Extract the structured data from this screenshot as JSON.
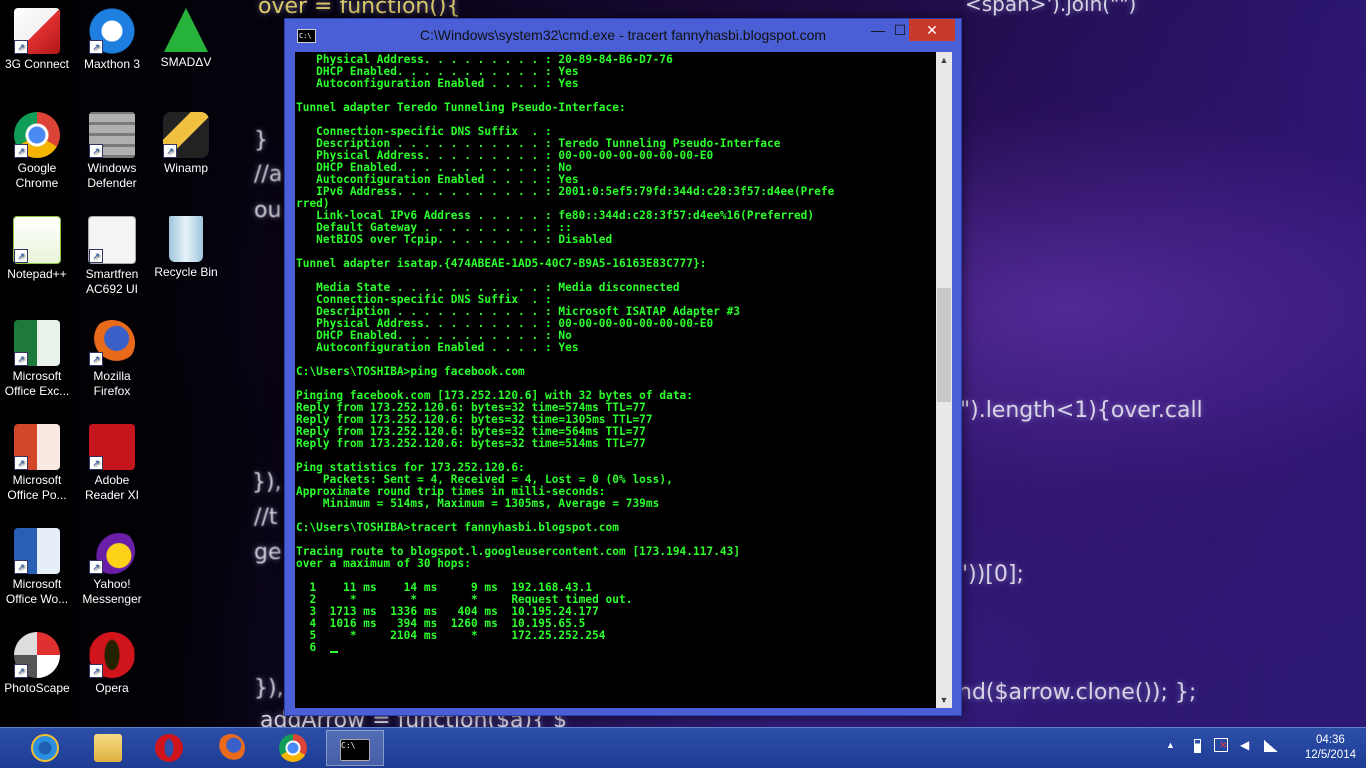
{
  "wallpaper": {
    "lines": [
      "over = function(){",
      "}",
      "//a",
      "ou",
      "}),",
      "//t",
      "ge",
      "}),",
      "addArrow = function($a){ $",
      "\").length<1){over.call",
      "\"))[0];",
      "nd($arrow.clone()); };",
      "<span>').join(\"\")"
    ]
  },
  "desktop_icons": [
    {
      "label": "3G Connect",
      "icon": "3g-connect-icon",
      "color": "#e03030"
    },
    {
      "label": "Maxthon 3",
      "icon": "maxthon-icon",
      "color": "#1e7fe0"
    },
    {
      "label": "SMADΔV",
      "icon": "smadav-icon",
      "color": "#27b23a"
    },
    {
      "label": "Google Chrome",
      "icon": "chrome-icon",
      "color": "#e8b020"
    },
    {
      "label": "Windows Defender",
      "icon": "windows-defender-icon",
      "color": "#9a9a9a"
    },
    {
      "label": "Winamp",
      "icon": "winamp-icon",
      "color": "#d8a020"
    },
    {
      "label": "Notepad++",
      "icon": "notepadpp-icon",
      "color": "#8fc040"
    },
    {
      "label": "Smartfren AC692 UI",
      "icon": "smartfren-icon",
      "color": "#d02030"
    },
    {
      "label": "Recycle Bin",
      "icon": "recycle-bin-icon",
      "color": "#cfe4f2"
    },
    {
      "label": "Microsoft Office Exc...",
      "icon": "excel-icon",
      "color": "#1e7a3c"
    },
    {
      "label": "Mozilla Firefox",
      "icon": "firefox-icon",
      "color": "#e86a1a"
    },
    {
      "label": "Microsoft Office Po...",
      "icon": "powerpoint-icon",
      "color": "#d2472a"
    },
    {
      "label": "Adobe Reader XI",
      "icon": "adobe-reader-icon",
      "color": "#c4161c"
    },
    {
      "label": "Microsoft Office Wo...",
      "icon": "word-icon",
      "color": "#2b5fb4"
    },
    {
      "label": "Yahoo! Messenger",
      "icon": "yahoo-messenger-icon",
      "color": "#6a1fa8"
    },
    {
      "label": "PhotoScape",
      "icon": "photoscape-icon",
      "color": "#555555"
    },
    {
      "label": "Opera",
      "icon": "opera-icon",
      "color": "#d0141c"
    }
  ],
  "cmd_window": {
    "title": "C:\\Windows\\system32\\cmd.exe - tracert  fannyhasbi.blogspot.com",
    "minimize": "—",
    "maximize": "☐",
    "close": "✕",
    "console_lines": [
      "   Physical Address. . . . . . . . . : 20-89-84-B6-D7-76",
      "   DHCP Enabled. . . . . . . . . . . : Yes",
      "   Autoconfiguration Enabled . . . . : Yes",
      "",
      "Tunnel adapter Teredo Tunneling Pseudo-Interface:",
      "",
      "   Connection-specific DNS Suffix  . :",
      "   Description . . . . . . . . . . . : Teredo Tunneling Pseudo-Interface",
      "   Physical Address. . . . . . . . . : 00-00-00-00-00-00-00-E0",
      "   DHCP Enabled. . . . . . . . . . . : No",
      "   Autoconfiguration Enabled . . . . : Yes",
      "   IPv6 Address. . . . . . . . . . . : 2001:0:5ef5:79fd:344d:c28:3f57:d4ee(Prefe",
      "rred)",
      "   Link-local IPv6 Address . . . . . : fe80::344d:c28:3f57:d4ee%16(Preferred)",
      "   Default Gateway . . . . . . . . . : ::",
      "   NetBIOS over Tcpip. . . . . . . . : Disabled",
      "",
      "Tunnel adapter isatap.{474ABEAE-1AD5-40C7-B9A5-16163E83C777}:",
      "",
      "   Media State . . . . . . . . . . . : Media disconnected",
      "   Connection-specific DNS Suffix  . :",
      "   Description . . . . . . . . . . . : Microsoft ISATAP Adapter #3",
      "   Physical Address. . . . . . . . . : 00-00-00-00-00-00-00-E0",
      "   DHCP Enabled. . . . . . . . . . . : No",
      "   Autoconfiguration Enabled . . . . : Yes",
      "",
      "C:\\Users\\TOSHIBA>ping facebook.com",
      "",
      "Pinging facebook.com [173.252.120.6] with 32 bytes of data:",
      "Reply from 173.252.120.6: bytes=32 time=574ms TTL=77",
      "Reply from 173.252.120.6: bytes=32 time=1305ms TTL=77",
      "Reply from 173.252.120.6: bytes=32 time=564ms TTL=77",
      "Reply from 173.252.120.6: bytes=32 time=514ms TTL=77",
      "",
      "Ping statistics for 173.252.120.6:",
      "    Packets: Sent = 4, Received = 4, Lost = 0 (0% loss),",
      "Approximate round trip times in milli-seconds:",
      "    Minimum = 514ms, Maximum = 1305ms, Average = 739ms",
      "",
      "C:\\Users\\TOSHIBA>tracert fannyhasbi.blogspot.com",
      "",
      "Tracing route to blogspot.l.googleusercontent.com [173.194.117.43]",
      "over a maximum of 30 hops:",
      "",
      "  1    11 ms    14 ms     9 ms  192.168.43.1",
      "  2     *        *        *     Request timed out.",
      "  3  1713 ms  1336 ms   404 ms  10.195.24.177",
      "  4  1016 ms   394 ms  1260 ms  10.195.65.5",
      "  5     *     2104 ms     *     172.25.252.254",
      "  6  "
    ]
  },
  "taskbar": {
    "pinned": [
      {
        "name": "ie",
        "icon": "internet-explorer-icon",
        "color": "#2a8fe0"
      },
      {
        "name": "explorer",
        "icon": "file-explorer-icon",
        "color": "#e8c45a"
      },
      {
        "name": "opera",
        "icon": "opera-icon",
        "color": "#d0141c"
      },
      {
        "name": "firefox",
        "icon": "firefox-icon",
        "color": "#e86a1a"
      },
      {
        "name": "chrome",
        "icon": "chrome-icon",
        "color": "#e8b020"
      },
      {
        "name": "cmd",
        "icon": "cmd-icon",
        "color": "#000000"
      }
    ],
    "tray": {
      "chevron": "▲"
    },
    "clock": {
      "time": "04:36",
      "date": "12/5/2014"
    }
  }
}
